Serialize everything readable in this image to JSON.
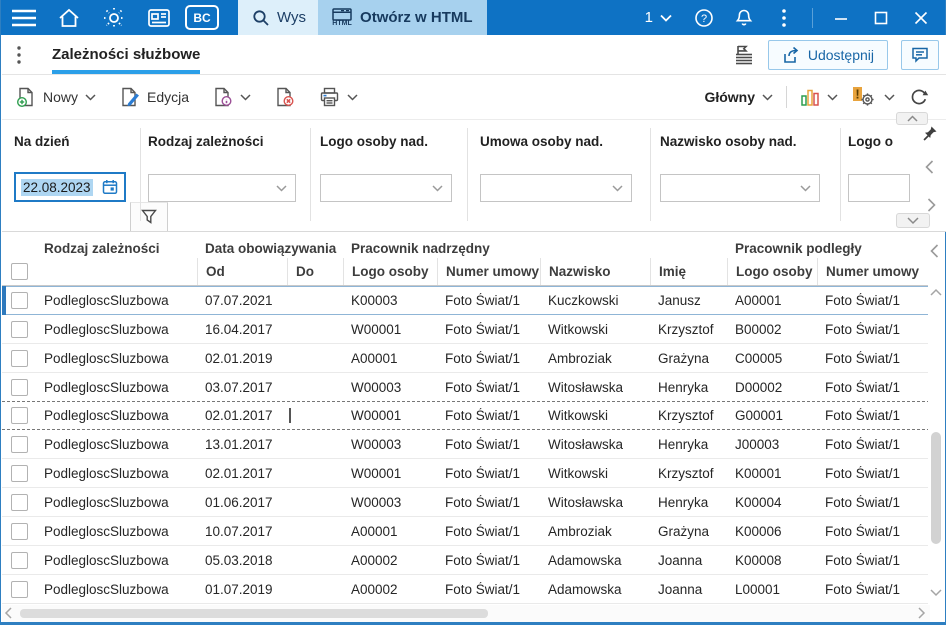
{
  "colors": {
    "topbar_bg": "#0e72c4",
    "accent_blue": "#2b88d8",
    "tab_underline": "#2b9fe8",
    "selection_highlight": "#aed6f2",
    "chart_green": "#2e9e4f",
    "chart_amber": "#e8a33d",
    "chart_red": "#d9534f"
  },
  "topbar": {
    "bc_badge": "BC",
    "search_text": "Wys",
    "html_icon_label": "HTML",
    "open_html_label": "Otwórz w HTML",
    "page_indicator": "1"
  },
  "title_row": {
    "title": "Zależności służbowe",
    "share_label": "Udostępnij"
  },
  "toolbar": {
    "new_label": "Nowy",
    "edit_label": "Edycja",
    "view_label": "Główny"
  },
  "filter_panel": {
    "fields": [
      {
        "label": "Na dzień",
        "value": "22.08.2023"
      },
      {
        "label": "Rodzaj zależności",
        "value": ""
      },
      {
        "label": "Logo osoby nad.",
        "value": ""
      },
      {
        "label": "Umowa osoby nad.",
        "value": ""
      },
      {
        "label": "Nazwisko osoby nad.",
        "value": ""
      },
      {
        "label": "Logo o",
        "value": ""
      }
    ]
  },
  "table": {
    "group_headers": {
      "rodzaj": "Rodzaj zależności",
      "data_obow": "Data obowiązywania",
      "prac_nad": "Pracownik nadrzędny",
      "prac_pod": "Pracownik podległy"
    },
    "sub_headers": {
      "od": "Od",
      "do": "Do",
      "logo_nad": "Logo osoby",
      "umowa_nad": "Numer umowy",
      "nazwisko": "Nazwisko",
      "imie": "Imię",
      "logo_pod": "Logo osoby",
      "umowa_pod": "Numer umowy"
    },
    "rows": [
      {
        "rodzaj": "PodlegloscSluzbowa",
        "od": "07.07.2021",
        "do": "",
        "logo_nad": "K00003",
        "umowa_nad": "Foto Świat/1",
        "nazwisko": "Kuczkowski",
        "imie": "Janusz",
        "logo_pod": "A00001",
        "umowa_pod": "Foto Świat/1"
      },
      {
        "rodzaj": "PodlegloscSluzbowa",
        "od": "16.04.2017",
        "do": "",
        "logo_nad": "W00001",
        "umowa_nad": "Foto Świat/1",
        "nazwisko": "Witkowski",
        "imie": "Krzysztof",
        "logo_pod": "B00002",
        "umowa_pod": "Foto Świat/1"
      },
      {
        "rodzaj": "PodlegloscSluzbowa",
        "od": "02.01.2019",
        "do": "",
        "logo_nad": "A00001",
        "umowa_nad": "Foto Świat/1",
        "nazwisko": "Ambroziak",
        "imie": "Grażyna",
        "logo_pod": "C00005",
        "umowa_pod": "Foto Świat/1"
      },
      {
        "rodzaj": "PodlegloscSluzbowa",
        "od": "03.07.2017",
        "do": "",
        "logo_nad": "W00003",
        "umowa_nad": "Foto Świat/1",
        "nazwisko": "Witosławska",
        "imie": "Henryka",
        "logo_pod": "D00002",
        "umowa_pod": "Foto Świat/1"
      },
      {
        "rodzaj": "PodlegloscSluzbowa",
        "od": "02.01.2017",
        "do": "",
        "logo_nad": "W00001",
        "umowa_nad": "Foto Świat/1",
        "nazwisko": "Witkowski",
        "imie": "Krzysztof",
        "logo_pod": "G00001",
        "umowa_pod": "Foto Świat/1"
      },
      {
        "rodzaj": "PodlegloscSluzbowa",
        "od": "13.01.2017",
        "do": "",
        "logo_nad": "W00003",
        "umowa_nad": "Foto Świat/1",
        "nazwisko": "Witosławska",
        "imie": "Henryka",
        "logo_pod": "J00003",
        "umowa_pod": "Foto Świat/1"
      },
      {
        "rodzaj": "PodlegloscSluzbowa",
        "od": "02.01.2017",
        "do": "",
        "logo_nad": "W00001",
        "umowa_nad": "Foto Świat/1",
        "nazwisko": "Witkowski",
        "imie": "Krzysztof",
        "logo_pod": "K00001",
        "umowa_pod": "Foto Świat/1"
      },
      {
        "rodzaj": "PodlegloscSluzbowa",
        "od": "01.06.2017",
        "do": "",
        "logo_nad": "W00003",
        "umowa_nad": "Foto Świat/1",
        "nazwisko": "Witosławska",
        "imie": "Henryka",
        "logo_pod": "K00004",
        "umowa_pod": "Foto Świat/1"
      },
      {
        "rodzaj": "PodlegloscSluzbowa",
        "od": "10.07.2017",
        "do": "",
        "logo_nad": "A00001",
        "umowa_nad": "Foto Świat/1",
        "nazwisko": "Ambroziak",
        "imie": "Grażyna",
        "logo_pod": "K00006",
        "umowa_pod": "Foto Świat/1"
      },
      {
        "rodzaj": "PodlegloscSluzbowa",
        "od": "05.03.2018",
        "do": "",
        "logo_nad": "A00002",
        "umowa_nad": "Foto Świat/1",
        "nazwisko": "Adamowska",
        "imie": "Joanna",
        "logo_pod": "K00008",
        "umowa_pod": "Foto Świat/1"
      },
      {
        "rodzaj": "PodlegloscSluzbowa",
        "od": "01.07.2019",
        "do": "",
        "logo_nad": "A00002",
        "umowa_nad": "Foto Świat/1",
        "nazwisko": "Adamowska",
        "imie": "Joanna",
        "logo_pod": "L00001",
        "umowa_pod": "Foto Świat/1"
      }
    ]
  }
}
